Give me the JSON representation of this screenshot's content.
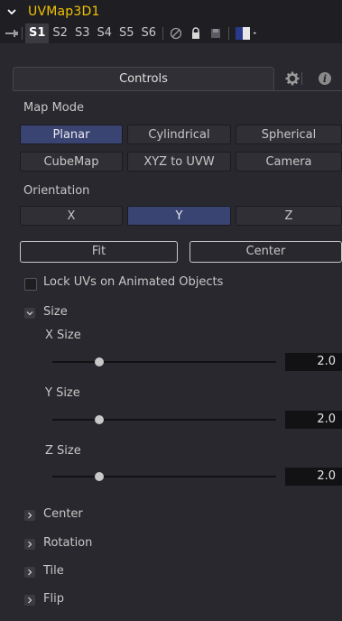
{
  "header": {
    "tool_name": "UVMap3D1",
    "slots": [
      "S1",
      "S2",
      "S3",
      "S4",
      "S5",
      "S6"
    ],
    "active_slot": "S1"
  },
  "tabs": {
    "active_label": "Controls",
    "icons": [
      "gear-icon",
      "info-icon"
    ]
  },
  "map_mode": {
    "label": "Map Mode",
    "options": [
      "Planar",
      "Cylindrical",
      "Spherical",
      "CubeMap",
      "XYZ to UVW",
      "Camera"
    ],
    "selected": "Planar"
  },
  "orientation": {
    "label": "Orientation",
    "options": [
      "X",
      "Y",
      "Z"
    ],
    "selected": "Y"
  },
  "actions": {
    "fit_label": "Fit",
    "center_label": "Center"
  },
  "lock_uvs": {
    "label": "Lock UVs on Animated Objects",
    "checked": false
  },
  "size_group": {
    "label": "Size",
    "expanded": true,
    "sliders": [
      {
        "label": "X Size",
        "value": "2.0",
        "fraction": 0.21
      },
      {
        "label": "Y Size",
        "value": "2.0",
        "fraction": 0.21
      },
      {
        "label": "Z Size",
        "value": "2.0",
        "fraction": 0.21
      }
    ]
  },
  "collapsed_groups": [
    "Center",
    "Rotation",
    "Tile",
    "Flip"
  ],
  "colors": {
    "title": "#f2c200",
    "selected_button": "#3a4472",
    "background": "#28282e"
  }
}
